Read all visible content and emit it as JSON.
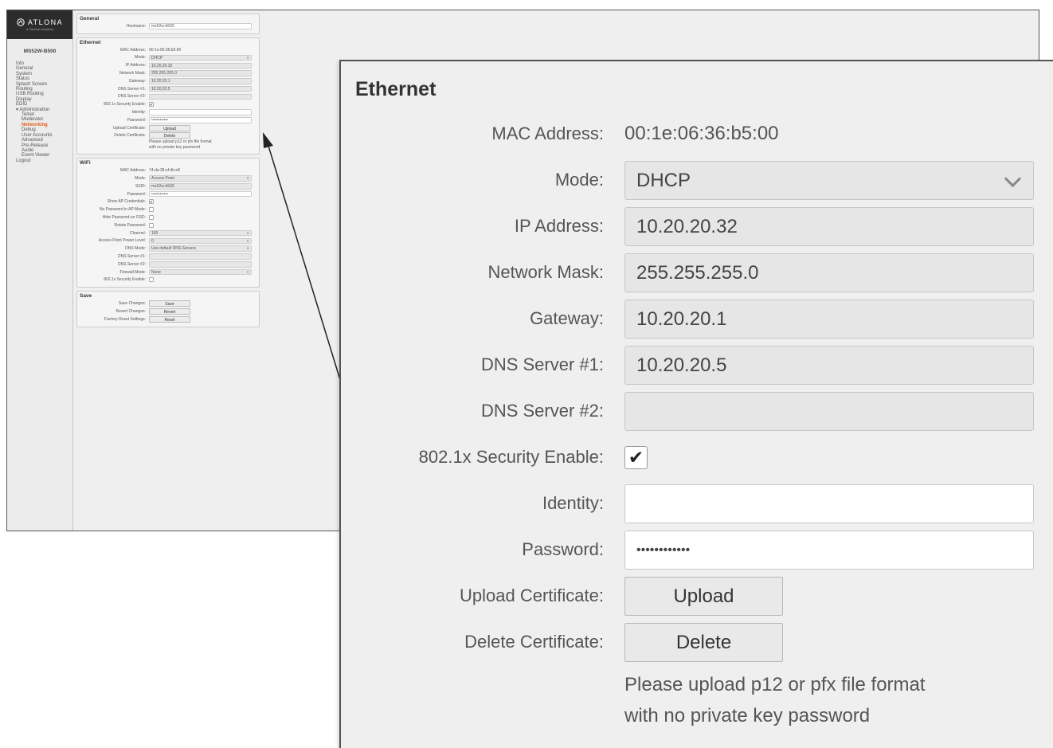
{
  "sidebar": {
    "logo_text": "ATLONA",
    "logo_sub": "a Panduit company",
    "device": "MS52W-B500",
    "items": [
      {
        "label": "Info",
        "level": 0
      },
      {
        "label": "General",
        "level": 0
      },
      {
        "label": "System",
        "level": 0
      },
      {
        "label": "Status",
        "level": 0
      },
      {
        "label": "Splash Screen",
        "level": 0
      },
      {
        "label": "Routing",
        "level": 0
      },
      {
        "label": "USB Routing",
        "level": 0
      },
      {
        "label": "Display",
        "level": 0
      },
      {
        "label": "EDID",
        "level": 0
      },
      {
        "label": "▾ Administration",
        "level": 0
      },
      {
        "label": "Telnet",
        "level": 1
      },
      {
        "label": "Moderator",
        "level": 1
      },
      {
        "label": "Networking",
        "level": 1,
        "active": true
      },
      {
        "label": "Debug",
        "level": 1
      },
      {
        "label": "User Accounts",
        "level": 1
      },
      {
        "label": "Advanced",
        "level": 1
      },
      {
        "label": "Pre-Release",
        "level": 1
      },
      {
        "label": "Audio",
        "level": 1
      },
      {
        "label": "Event Viewer",
        "level": 1
      },
      {
        "label": "Logout",
        "level": 0
      }
    ]
  },
  "general": {
    "title": "General",
    "hostname_label": "Hostname:",
    "hostname": "ms52w-b500"
  },
  "ethernet": {
    "title": "Ethernet",
    "mac_label": "MAC Address:",
    "mac": "00:1e:06:36:b5:00",
    "mode_label": "Mode:",
    "mode": "DHCP",
    "ip_label": "IP Address:",
    "ip": "10.20.20.32",
    "mask_label": "Network Mask:",
    "mask": "255.255.255.0",
    "gateway_label": "Gateway:",
    "gateway": "10.20.20.1",
    "dns1_label": "DNS Server #1:",
    "dns1": "10.20.20.5",
    "dns2_label": "DNS Server #2:",
    "dns2": "",
    "security_label": "802.1x Security Enable:",
    "security_checked": true,
    "identity_label": "Identity:",
    "identity": "",
    "password_label": "Password:",
    "password": "••••••••••••",
    "upload_label": "Upload Certificate:",
    "upload_btn": "Upload",
    "delete_label": "Delete Certificate:",
    "delete_btn": "Delete",
    "note_line1": "Please upload p12 or pfx file format",
    "note_line2": "with no private key password"
  },
  "wifi": {
    "title": "WiFi",
    "mac_label": "MAC Address:",
    "mac": "74:da:38:ef:db:e8",
    "mode_label": "Mode:",
    "mode": "Access Point",
    "ssid_label": "SSID:",
    "ssid": "ms52w-b500",
    "password_label": "Password:",
    "password": "••••••••••••",
    "show_ap_label": "Show AP Credentials:",
    "no_pw_label": "No Password in AP Mode:",
    "hide_pw_label": "Hide Password on OSD:",
    "rotate_label": "Rotate Password:",
    "channel_label": "Channel:",
    "channel": "165",
    "power_label": "Access Point Power Level:",
    "power": "0",
    "dns_mode_label": "DNS Mode:",
    "dns_mode": "Use default DNS Servers",
    "dns1_label": "DNS Server #1:",
    "dns2_label": "DNS Server #2:",
    "firewall_label": "Firewall Mode:",
    "firewall": "None",
    "security_label": "802.1x Security Enable:"
  },
  "save": {
    "title": "Save",
    "save_label": "Save Changes:",
    "save_btn": "Save",
    "revert_label": "Revert Changes:",
    "revert_btn": "Revert",
    "reset_label": "Factory Reset Settings:",
    "reset_btn": "Reset"
  },
  "icons": {
    "mode_dropdown": "chevron-down-icon",
    "security_check": "checkmark-icon",
    "logo": "atlona-logo-icon"
  }
}
